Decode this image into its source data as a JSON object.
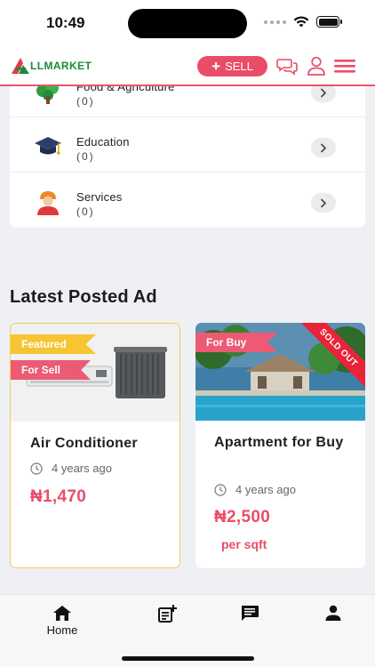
{
  "status": {
    "time": "10:49"
  },
  "header": {
    "logo_text": "LLMARKET",
    "sell_label": "SELL"
  },
  "categories": [
    {
      "name": "Food & Agriculture",
      "count": "(0)",
      "icon": "plant-icon"
    },
    {
      "name": "Education",
      "count": "(0)",
      "icon": "graduation-cap-icon"
    },
    {
      "name": "Services",
      "count": "(0)",
      "icon": "worker-icon"
    }
  ],
  "section_title": "Latest Posted Ad",
  "ads": [
    {
      "tag_featured": "Featured",
      "tag_type": "For Sell",
      "title": "Air Conditioner",
      "time": "4 years ago",
      "price": "₦1,470"
    },
    {
      "tag_type": "For Buy",
      "ribbon": "SOLD OUT",
      "title": "Apartment for Buy",
      "time": "4 years ago",
      "price": "₦2,500",
      "unit": "per sqft"
    }
  ],
  "nav": {
    "home_label": "Home"
  },
  "colors": {
    "accent": "#ea4d67",
    "logo_green": "#1b8a3a",
    "featured_yellow": "#f7c531"
  }
}
